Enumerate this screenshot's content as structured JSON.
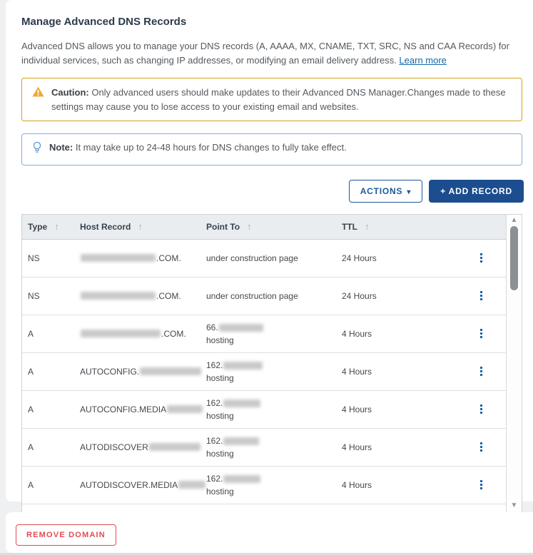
{
  "page": {
    "title": "Manage Advanced DNS Records",
    "description": "Advanced DNS allows you to manage your DNS records (A, AAAA, MX, CNAME, TXT, SRC, NS and CAA Records) for individual services, such as changing IP addresses, or modifying an email delivery address. ",
    "learn_more_label": "Learn more"
  },
  "caution_banner": {
    "icon": "warning-triangle-icon",
    "label": "Caution:",
    "text": " Only advanced users should make updates to their Advanced DNS Manager.Changes made to these settings may cause you to lose access to your existing email and websites."
  },
  "note_banner": {
    "icon": "lightbulb-icon",
    "label": "Note:",
    "text": " It may take up to 24-48 hours for DNS changes to fully take effect."
  },
  "toolbar": {
    "actions_label": "ACTIONS",
    "actions_caret": "▾",
    "add_record_label": "+  ADD RECORD"
  },
  "table": {
    "columns": [
      "Type",
      "Host Record",
      "Point To",
      "TTL"
    ],
    "sort_icon": "↑",
    "rows": [
      {
        "type": "NS",
        "host_prefix": "",
        "host_redacted_width": 105,
        "host_suffix": ".COM.",
        "point_prefix": "under construction page",
        "point_redacted_width": 0,
        "point_line2": "",
        "ttl": "24 Hours"
      },
      {
        "type": "NS",
        "host_prefix": "",
        "host_redacted_width": 105,
        "host_suffix": ".COM.",
        "point_prefix": "under construction page",
        "point_redacted_width": 0,
        "point_line2": "",
        "ttl": "24 Hours"
      },
      {
        "type": "A",
        "host_prefix": "",
        "host_redacted_width": 112,
        "host_suffix": ".COM.",
        "point_prefix": "66.",
        "point_redacted_width": 62,
        "point_line2": "hosting",
        "ttl": "4 Hours"
      },
      {
        "type": "A",
        "host_prefix": "AUTOCONFIG.",
        "host_redacted_width": 86,
        "host_suffix": "",
        "point_prefix": "162.",
        "point_redacted_width": 55,
        "point_line2": "hosting",
        "ttl": "4 Hours"
      },
      {
        "type": "A",
        "host_prefix": "AUTOCONFIG.MEDIA",
        "host_redacted_width": 50,
        "host_suffix": "",
        "point_prefix": "162.",
        "point_redacted_width": 52,
        "point_line2": "hosting",
        "ttl": "4 Hours"
      },
      {
        "type": "A",
        "host_prefix": "AUTODISCOVER",
        "host_redacted_width": 72,
        "host_suffix": "",
        "point_prefix": "162.",
        "point_redacted_width": 50,
        "point_line2": "hosting",
        "ttl": "4 Hours"
      },
      {
        "type": "A",
        "host_prefix": "AUTODISCOVER.MEDIA",
        "host_redacted_width": 44,
        "host_suffix": "",
        "point_prefix": "162.",
        "point_redacted_width": 52,
        "point_line2": "hosting",
        "ttl": "4 Hours"
      }
    ]
  },
  "footer": {
    "remove_domain_label": "REMOVE DOMAIN"
  },
  "colors": {
    "primary_blue": "#19599d",
    "add_button_navy": "#1b4d8f",
    "caution_border_gold": "#d1a219",
    "caution_icon_amber": "#f0a92e",
    "note_border_blue": "#85aed6",
    "note_icon_blue": "#5b9bd5",
    "remove_red": "#e14b52",
    "header_bg": "#e9edf0",
    "link_blue": "#1266a8"
  }
}
